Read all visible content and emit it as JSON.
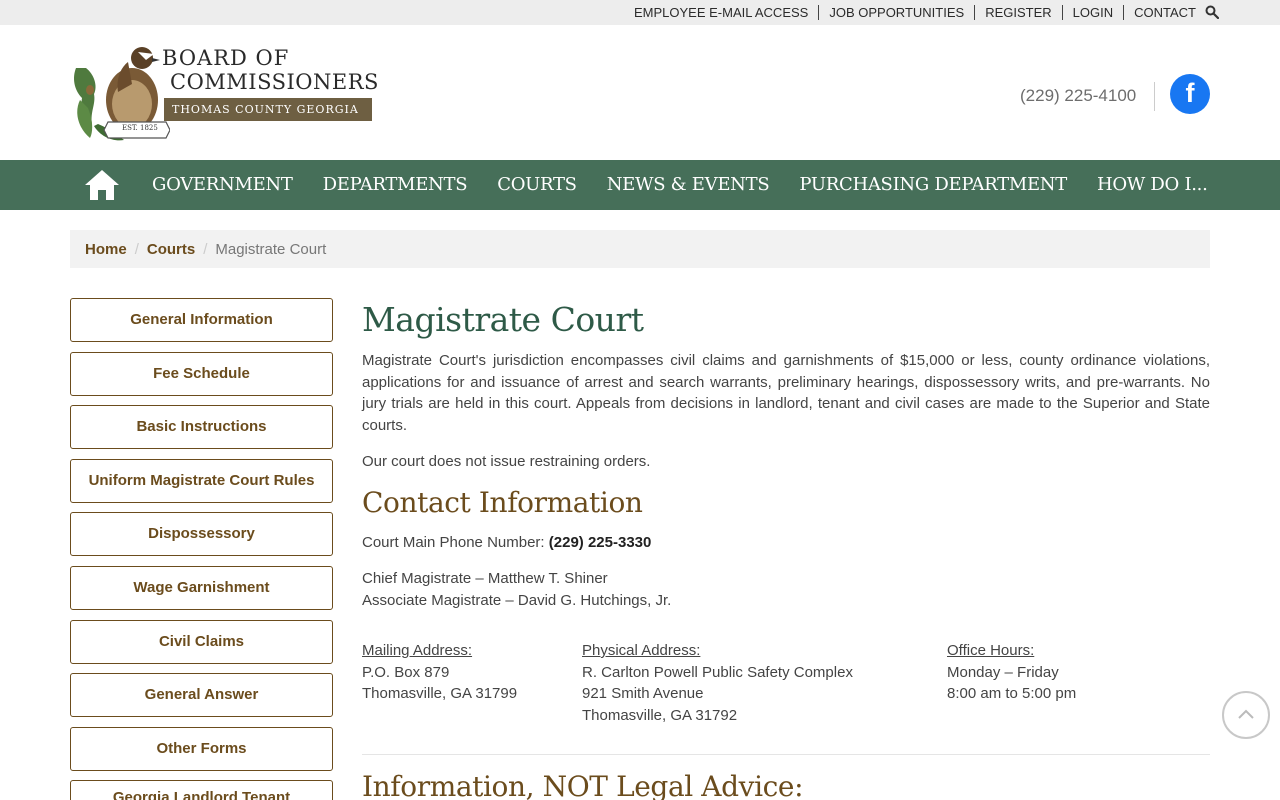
{
  "topbar": {
    "links": [
      "EMPLOYEE E-MAIL ACCESS",
      "JOB OPPORTUNITIES",
      "REGISTER",
      "LOGIN",
      "CONTACT"
    ],
    "search_icon": "search-icon"
  },
  "header": {
    "logo_line1": "BOARD OF",
    "logo_line2": "COMMISSIONERS",
    "logo_line3": "THOMAS COUNTY GEORGIA",
    "logo_est": "EST. 1825",
    "phone": "(229) 225-4100",
    "facebook_icon": "facebook-icon"
  },
  "nav": {
    "home_icon": "home-icon",
    "items": [
      "GOVERNMENT",
      "DEPARTMENTS",
      "COURTS",
      "NEWS & EVENTS",
      "PURCHASING DEPARTMENT",
      "HOW DO I..."
    ]
  },
  "breadcrumb": {
    "home": "Home",
    "courts": "Courts",
    "current": "Magistrate Court",
    "sep": "/"
  },
  "sidebar": {
    "items": [
      "General Information",
      "Fee Schedule",
      "Basic Instructions",
      "Uniform Magistrate Court Rules",
      "Dispossessory",
      "Wage Garnishment",
      "Civil Claims",
      "General Answer",
      "Other Forms",
      "Georgia Landlord Tenant"
    ]
  },
  "content": {
    "title": "Magistrate Court",
    "intro": "Magistrate Court's jurisdiction encompasses civil claims and garnishments of $15,000 or less, county ordinance violations, applications for and issuance of arrest and search warrants, preliminary hearings, dispossessory writs, and pre-warrants. No jury trials are held in this court. Appeals from decisions in landlord, tenant and civil cases are made to the Superior and State courts.",
    "restraining": "Our court does not issue restraining orders.",
    "contact_heading": "Contact Information",
    "phone_label": "Court Main Phone Number: ",
    "phone_value": "(229) 225-3330",
    "chief": "Chief Magistrate – Matthew T. Shiner",
    "associate": "Associate Magistrate – David G. Hutchings, Jr.",
    "mailing": {
      "heading": "Mailing Address:",
      "line1": "P.O. Box 879",
      "line2": "Thomasville, GA 31799"
    },
    "physical": {
      "heading": "Physical Address:",
      "line1": "R. Carlton Powell Public Safety Complex",
      "line2": "921 Smith Avenue",
      "line3": "Thomasville, GA 31792"
    },
    "hours": {
      "heading": "Office Hours:",
      "line1": "Monday – Friday",
      "line2": "8:00 am to 5:00 pm"
    },
    "legal_heading": "Information, NOT Legal Advice:"
  },
  "back_to_top_icon": "chevron-up-icon",
  "colors": {
    "nav_green": "#466f59",
    "heading_green": "#2e5a47",
    "brown": "#6b4c1d",
    "facebook_blue": "#1877f2"
  }
}
